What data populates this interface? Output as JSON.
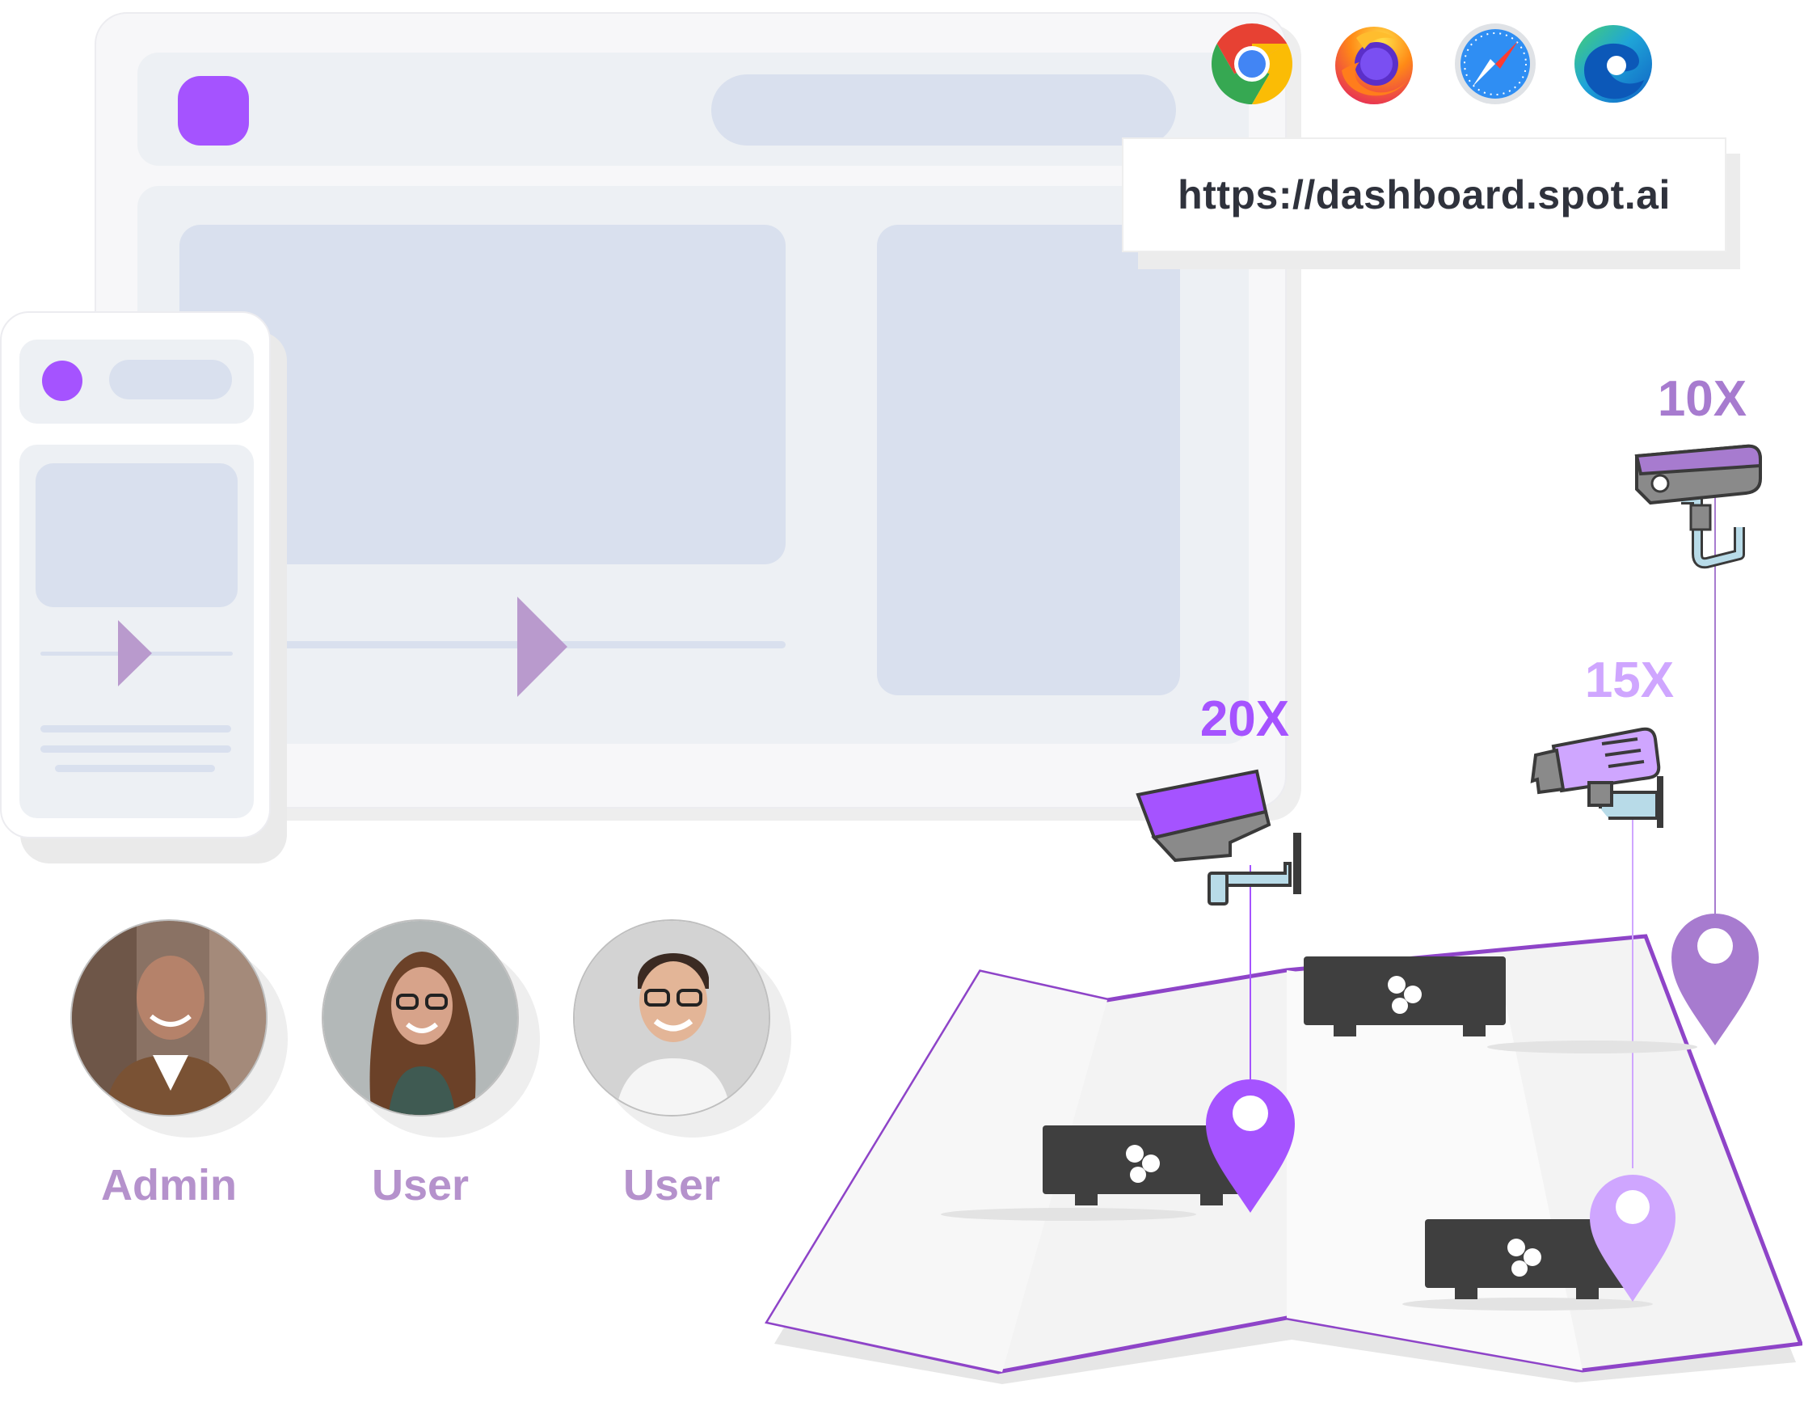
{
  "browsers": [
    {
      "name": "chrome-icon"
    },
    {
      "name": "firefox-icon"
    },
    {
      "name": "safari-icon"
    },
    {
      "name": "edge-icon"
    }
  ],
  "url": "https://dashboard.spot.ai",
  "users": [
    {
      "role": "Admin"
    },
    {
      "role": "User"
    },
    {
      "role": "User"
    }
  ],
  "cameras": [
    {
      "zoom": "20X",
      "color": "#a553ff"
    },
    {
      "zoom": "10X",
      "color": "#a77bcf"
    },
    {
      "zoom": "15X",
      "color": "#cfa6ff"
    }
  ],
  "colors": {
    "accent": "#a553ff",
    "role_text": "#b592cc",
    "map_outline": "#8e44c8",
    "device": "#3f3f3f"
  }
}
